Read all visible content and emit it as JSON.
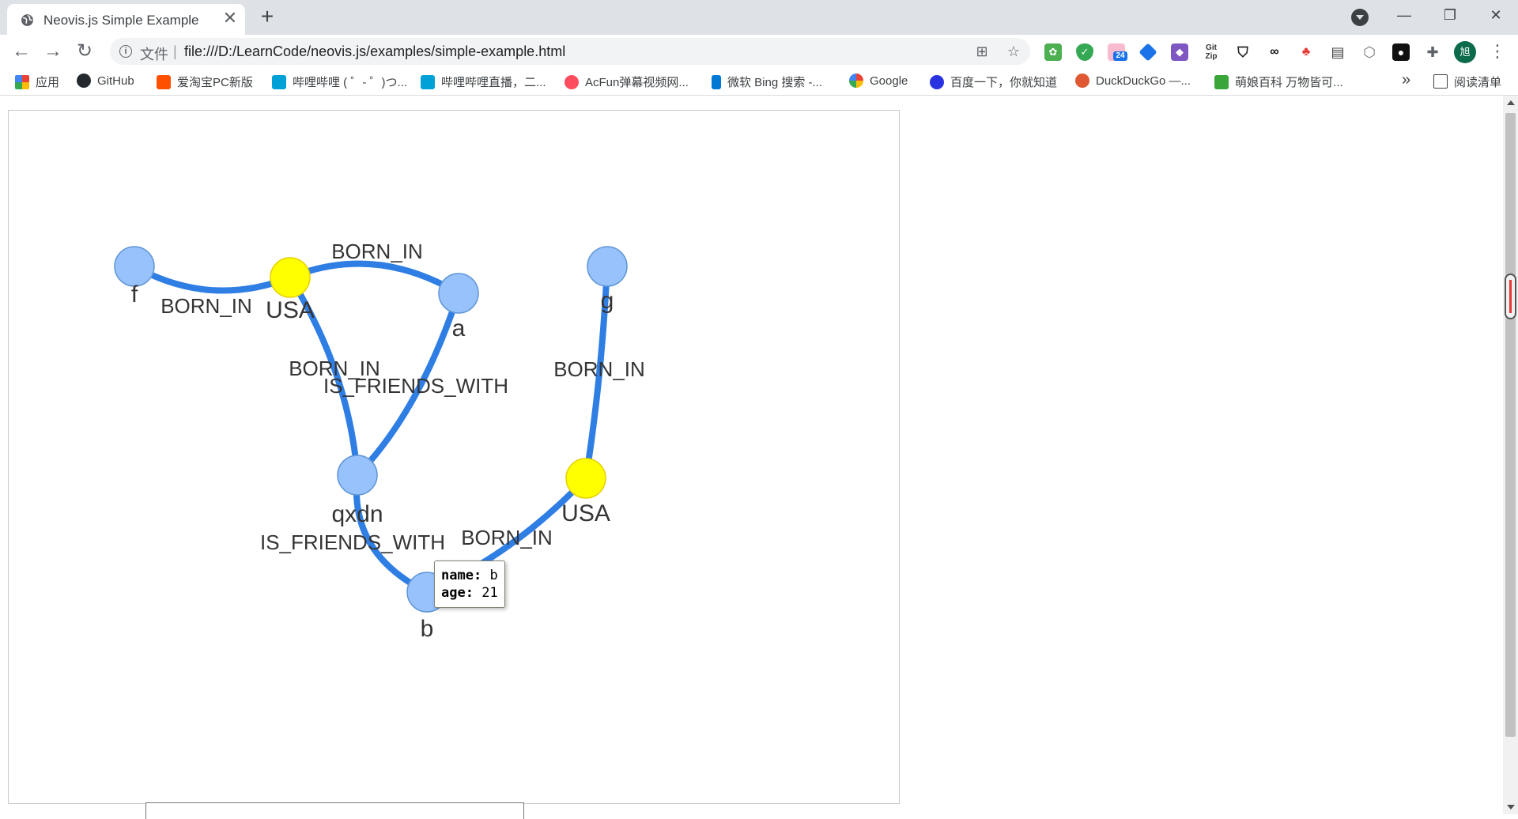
{
  "browser": {
    "tab": {
      "title": "Neovis.js Simple Example",
      "close": "✕"
    },
    "new_tab": "+",
    "window": {
      "minimize": "—",
      "restore": "❐",
      "close": "✕"
    },
    "address": {
      "scheme_label": "文件",
      "separator": "|",
      "url": "file:///D:/LearnCode/neovis.js/examples/simple-example.html"
    },
    "extension_badge": "24",
    "profile_initial": "旭"
  },
  "bookmarks": {
    "items": [
      {
        "label": "应用",
        "icon": "apps-grid-icon",
        "color": "#ea4335"
      },
      {
        "label": "GitHub",
        "icon": "github-icon",
        "color": "#24292e"
      },
      {
        "label": "爱淘宝PC新版",
        "icon": "taobao-icon",
        "color": "#ff5000"
      },
      {
        "label": "哔哩哔哩 ( ゜- ゜)つ...",
        "icon": "bilibili-icon",
        "color": "#00a1d6"
      },
      {
        "label": "哔哩哔哩直播，二...",
        "icon": "bilibili-live-icon",
        "color": "#00a1d6"
      },
      {
        "label": "AcFun弹幕视频网...",
        "icon": "acfun-icon",
        "color": "#fd4c5d"
      },
      {
        "label": "微软 Bing 搜索 -...",
        "icon": "bing-icon",
        "color": "#0078d4"
      },
      {
        "label": "Google",
        "icon": "google-icon",
        "color": "#4285f4"
      },
      {
        "label": "百度一下，你就知道",
        "icon": "baidu-icon",
        "color": "#2932e1"
      },
      {
        "label": "DuckDuckGo —...",
        "icon": "duckduckgo-icon",
        "color": "#de5833"
      },
      {
        "label": "萌娘百科 万物皆可...",
        "icon": "moegirl-icon",
        "color": "#3aa639"
      }
    ],
    "more": "»",
    "reading_list": "阅读清单"
  },
  "graph": {
    "colors": {
      "edge": "#2f7ee4",
      "person_node": "#97c2fc",
      "place_node": "#ffff00"
    },
    "nodes": [
      {
        "id": "f",
        "label": "f",
        "type": "person"
      },
      {
        "id": "usa1",
        "label": "USA",
        "type": "place"
      },
      {
        "id": "a",
        "label": "a",
        "type": "person"
      },
      {
        "id": "g",
        "label": "g",
        "type": "person"
      },
      {
        "id": "qxdn",
        "label": "qxdn",
        "type": "person"
      },
      {
        "id": "usa2",
        "label": "USA",
        "type": "place"
      },
      {
        "id": "b",
        "label": "b",
        "type": "person"
      }
    ],
    "edges": [
      {
        "from": "f",
        "to": "usa1",
        "label": "BORN_IN"
      },
      {
        "from": "usa1",
        "to": "a",
        "label": "BORN_IN"
      },
      {
        "from": "usa1",
        "to": "qxdn",
        "label": "BORN_IN"
      },
      {
        "from": "a",
        "to": "qxdn",
        "label": "IS_FRIENDS_WITH"
      },
      {
        "from": "g",
        "to": "usa2",
        "label": "BORN_IN"
      },
      {
        "from": "qxdn",
        "to": "b",
        "label": "IS_FRIENDS_WITH"
      },
      {
        "from": "usa2",
        "to": "b",
        "label": "BORN_IN"
      }
    ],
    "tooltip": {
      "name_key": "name:",
      "name_value": "b",
      "age_key": "age:",
      "age_value": "21"
    }
  }
}
